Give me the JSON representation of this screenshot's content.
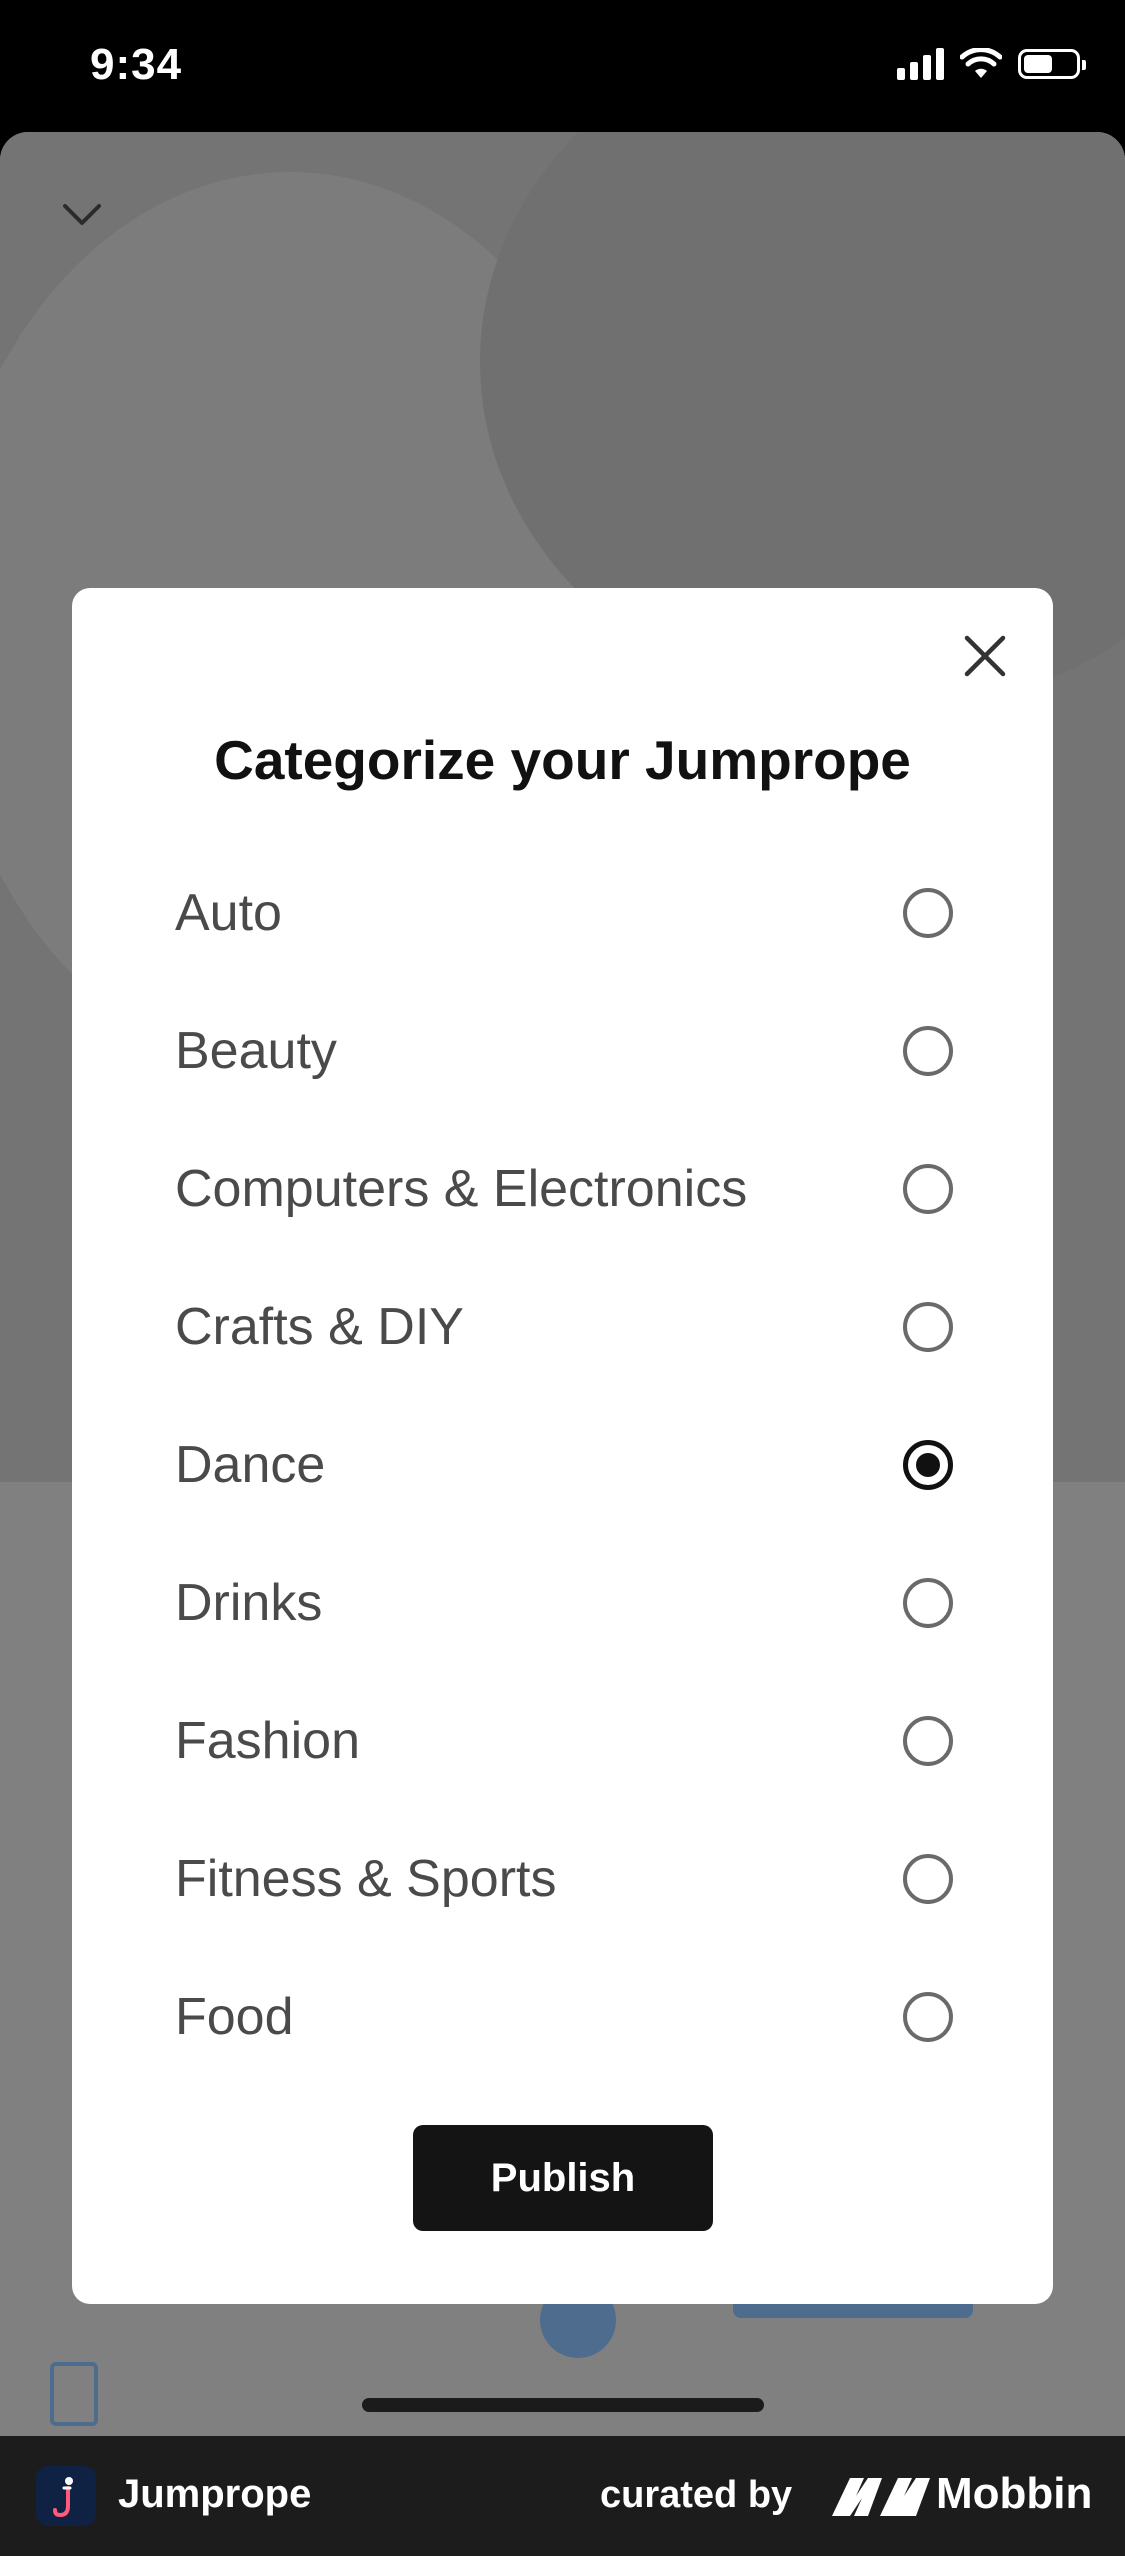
{
  "status_bar": {
    "time": "9:34"
  },
  "modal": {
    "title": "Categorize your Jumprope",
    "options": [
      {
        "label": "Auto",
        "selected": false
      },
      {
        "label": "Beauty",
        "selected": false
      },
      {
        "label": "Computers & Electronics",
        "selected": false
      },
      {
        "label": "Crafts & DIY",
        "selected": false
      },
      {
        "label": "Dance",
        "selected": true
      },
      {
        "label": "Drinks",
        "selected": false
      },
      {
        "label": "Fashion",
        "selected": false
      },
      {
        "label": "Fitness & Sports",
        "selected": false
      },
      {
        "label": "Food",
        "selected": false
      }
    ],
    "publish_label": "Publish"
  },
  "footer": {
    "app_name": "Jumprope",
    "curated_label": "curated by",
    "brand_name": "Mobbin"
  },
  "icons": {
    "close": "close-icon",
    "chevron": "chevron-down-icon",
    "radio_unchecked": "radio-unchecked-icon",
    "radio_checked": "radio-checked-icon"
  }
}
